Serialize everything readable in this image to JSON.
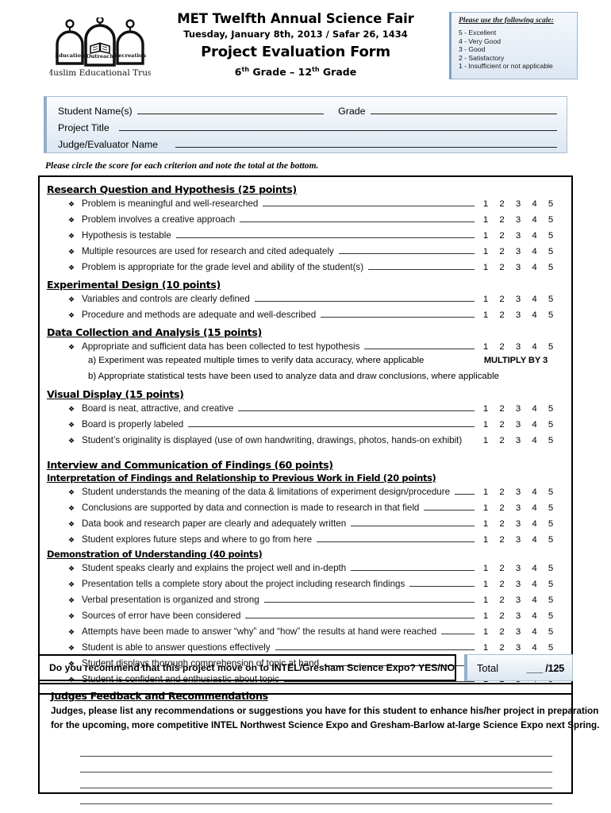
{
  "header": {
    "org_name": "Muslim Educational Trust",
    "logo_labels": [
      "Education",
      "Outreach",
      "Recreation"
    ],
    "title_line1": "MET Twelfth Annual Science Fair",
    "title_line2": "Tuesday, January 8th, 2013 / Safar 26, 1434",
    "title_line3": "Project Evaluation Form",
    "grade_range_prefix": "6",
    "grade_range_sup1": "th",
    "grade_range_mid": " Grade – 12",
    "grade_range_sup2": "th",
    "grade_range_suffix": " Grade"
  },
  "scale": {
    "title": "Please use the following scale:",
    "items": [
      "5 - Excellent",
      "4 - Very Good",
      "3 - Good",
      "2 - Satisfactory",
      "1 - Insufficient or not applicable"
    ],
    "accent_color": "#8fafcd"
  },
  "student_info": {
    "student_name_label": "Student Name(s)",
    "grade_label": "Grade",
    "project_title_label": "Project Title",
    "judge_label": "Judge/Evaluator Name",
    "student_name_value": "",
    "grade_value": "",
    "project_title_value": "",
    "judge_value": ""
  },
  "instruction": "Please circle the score for each criterion and note the total at the bottom.",
  "score_options": [
    "1",
    "2",
    "3",
    "4",
    "5"
  ],
  "sections": [
    {
      "heading": "Research Question and Hypothesis (25 points)",
      "items": [
        "Problem is meaningful and well-researched",
        "Problem involves a creative approach",
        "Hypothesis is testable",
        "Multiple resources are used for research and cited adequately",
        "Problem is appropriate for the grade level and ability of the student(s)"
      ]
    },
    {
      "heading": "Experimental Design (10 points)",
      "items": [
        "Variables and controls are clearly defined",
        "Procedure and methods are adequate and well-described"
      ]
    },
    {
      "heading": "Data Collection and Analysis (15 points)",
      "items": [
        "Appropriate and sufficient data has been collected to test hypothesis"
      ],
      "subnotes": [
        {
          "text": "a) Experiment was repeated multiple times to verify data accuracy, where applicable",
          "note": "MULTIPLY BY 3"
        },
        {
          "text": "b) Appropriate statistical tests have been used to analyze data and draw conclusions, where applicable",
          "note": ""
        }
      ]
    },
    {
      "heading": "Visual Display (15 points)",
      "items": [
        "Board is neat, attractive, and creative",
        "Board is properly labeled",
        "Student’s originality is displayed (use of own handwriting, drawings, photos, hands-on exhibit)"
      ]
    },
    {
      "heading": "Interview and Communication of Findings (60 points)",
      "subheading": "Interpretation of Findings and Relationship to Previous Work in Field (20 points)",
      "items": [
        "Student understands the meaning of the data & limitations of experiment design/procedure",
        "Conclusions are supported by data and connection is made to research in that field",
        "Data book and research paper are clearly and adequately written",
        "Student explores future steps and where to go from here"
      ]
    },
    {
      "heading": "Demonstration of Understanding (40 points)",
      "items": [
        "Student speaks clearly and explains the project well and in-depth",
        "Presentation tells a complete story about the project including research findings",
        "Verbal presentation is organized and strong",
        "Sources of error have been considered",
        "Attempts have been made to answer “why” and “how” the results at hand were reached",
        "Student is able to answer questions effectively",
        "Student displays thorough comprehension of topic at hand",
        "Student is confident and enthusiastic about topic"
      ]
    }
  ],
  "recommendation": {
    "question": "Do you recommend that this project move on to INTEL/Gresham Science Expo? YES/NO",
    "total_label": "Total",
    "total_value": "___ /125"
  },
  "feedback": {
    "heading": "Judges Feedback and Recommendations",
    "line1": "Judges, please list any recommendations or suggestions you have for this student to enhance his/her project in preparation",
    "line2": "for the upcoming, more competitive INTEL Northwest Science Expo and Gresham-Barlow at-large Science Expo next Spring.",
    "blank_line_count": 4
  },
  "bullet_glyph": "❖"
}
